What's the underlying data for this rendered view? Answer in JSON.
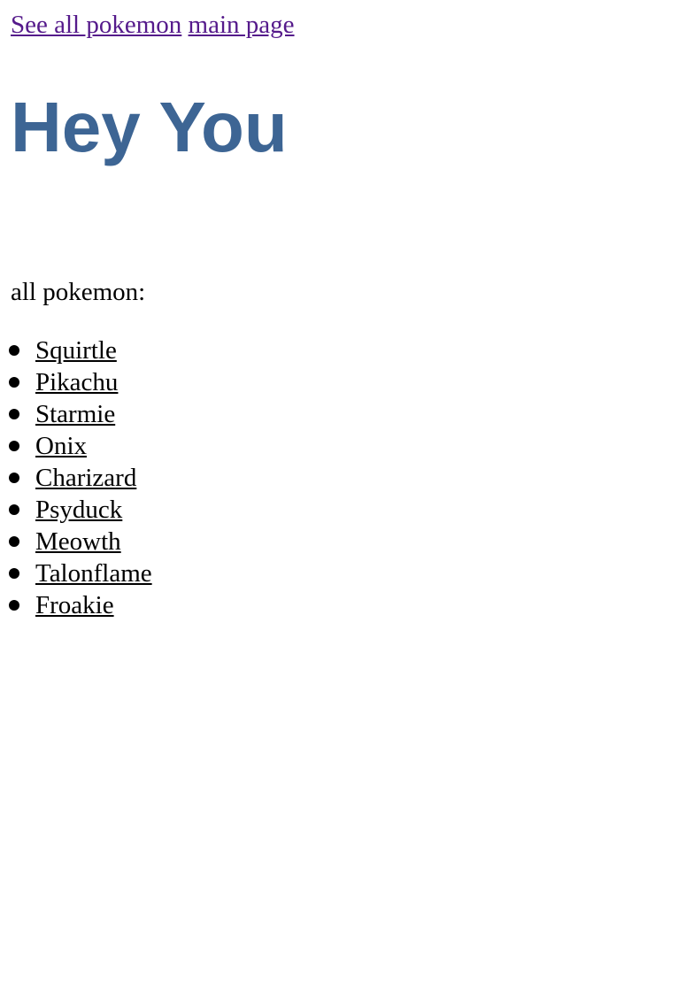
{
  "nav": {
    "links": [
      {
        "label": "See all pokemon"
      },
      {
        "label": "main page"
      }
    ]
  },
  "hero": {
    "title": "Hey You"
  },
  "list_label": "all pokemon:",
  "pokemon": [
    {
      "name": "Squirtle"
    },
    {
      "name": "Pikachu"
    },
    {
      "name": "Starmie"
    },
    {
      "name": "Onix"
    },
    {
      "name": "Charizard"
    },
    {
      "name": "Psyduck"
    },
    {
      "name": "Meowth"
    },
    {
      "name": "Talonflame"
    },
    {
      "name": "Froakie"
    }
  ],
  "colors": {
    "title": "#3d6594",
    "visited_link": "#551a8b",
    "text": "#000000",
    "background": "#ffffff"
  }
}
